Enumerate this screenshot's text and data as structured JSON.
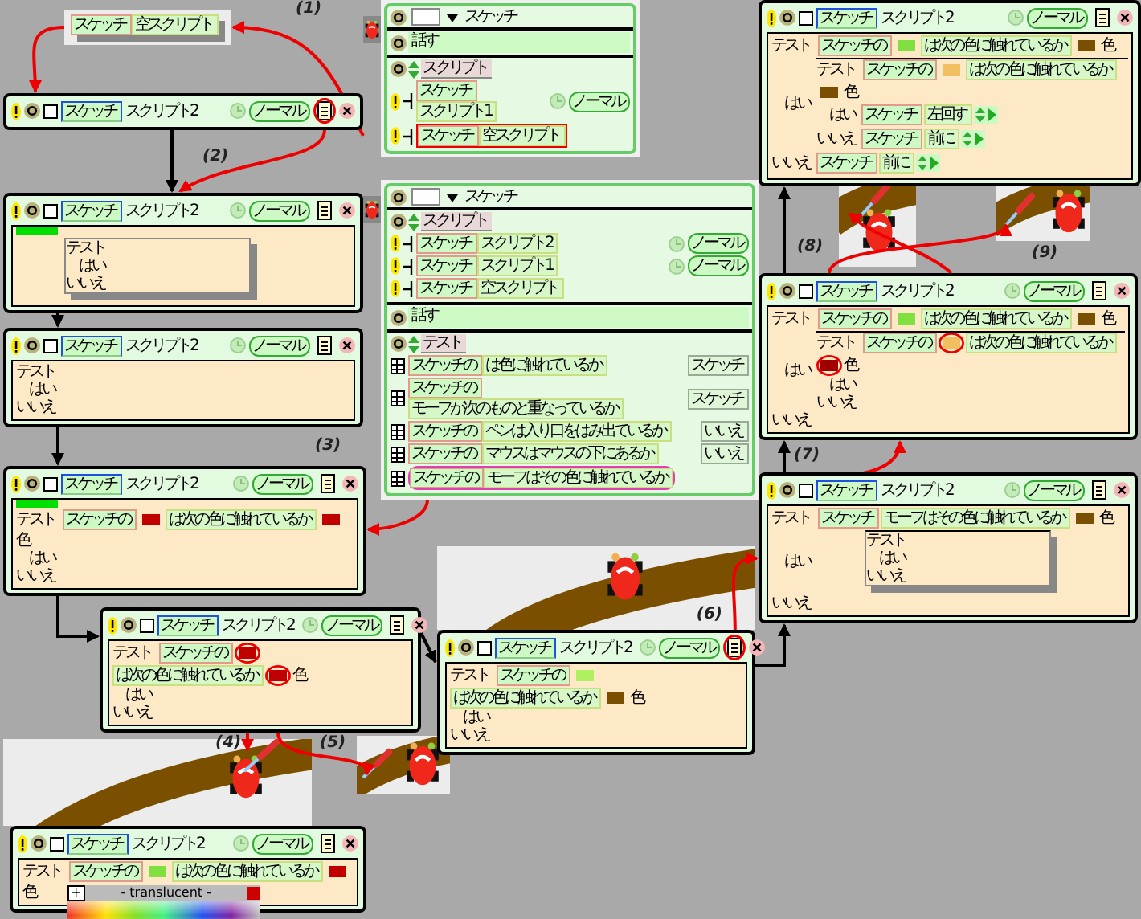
{
  "tile_drag": {
    "tiles": [
      {
        "kind": "object",
        "text": "スケッチ"
      },
      {
        "kind": "phrase",
        "text": "空スクリプト"
      }
    ]
  },
  "viewers": [
    {
      "name": "スケッチ",
      "panes": [
        {
          "kind": "speech",
          "text": "話す"
        },
        {
          "kind": "category",
          "title": "スクリプト",
          "rows": [
            {
              "kind": "script",
              "object": "スケッチ",
              "command": "スクリプト1",
              "mode": "ノーマル",
              "circled": false
            },
            {
              "kind": "script",
              "object": "スケッチ",
              "command": "空スクリプト",
              "circled": true
            }
          ]
        }
      ]
    },
    {
      "name": "スケッチ",
      "panes": [
        {
          "kind": "category",
          "title": "スクリプト",
          "rows": [
            {
              "kind": "script",
              "object": "スケッチ",
              "command": "スクリプト2",
              "mode": "ノーマル",
              "circled": false
            },
            {
              "kind": "script",
              "object": "スケッチ",
              "command": "スクリプト1",
              "mode": "ノーマル",
              "circled": false
            },
            {
              "kind": "script",
              "object": "スケッチ",
              "command": "空スクリプト",
              "circled": false
            }
          ]
        },
        {
          "kind": "speech",
          "text": "話す"
        },
        {
          "kind": "category",
          "title": "テスト",
          "rows": [
            {
              "kind": "test",
              "object": "スケッチの",
              "command": "は色に触れているか",
              "value": "スケッチ",
              "circled": false
            },
            {
              "kind": "test",
              "object": "スケッチの",
              "command": "モーフが次のものと重なっているか",
              "value": "スケッチ",
              "circled": false
            },
            {
              "kind": "test",
              "object": "スケッチの",
              "command": "ペンは入り口をはみ出ているか",
              "value": "いいえ",
              "circled": false
            },
            {
              "kind": "test",
              "object": "スケッチの",
              "command": "マウスはマウスの下にあるか",
              "value": "いいえ",
              "circled": false
            },
            {
              "kind": "test",
              "object": "スケッチの",
              "command": "モーフはその色に触れているか",
              "circled": true
            }
          ]
        }
      ]
    }
  ],
  "scripts": [
    {
      "name": "スケッチ",
      "title": "スクリプト2",
      "mode": "ノーマル",
      "checked": false,
      "menu_circled": true,
      "drop_highlight": false
    },
    {
      "name": "スケッチ",
      "title": "スクリプト2",
      "mode": "ノーマル",
      "checked": false,
      "menu_circled": false,
      "drop_highlight": true,
      "test": {
        "label": "テスト",
        "yes": "はい",
        "no": "いいえ",
        "floating": true
      }
    },
    {
      "name": "スケッチ",
      "title": "スクリプト2",
      "mode": "ノーマル",
      "checked": false,
      "menu_circled": false,
      "drop_highlight": false,
      "test": {
        "label": "テスト",
        "yes": "はい",
        "no": "いいえ",
        "floating": false
      }
    },
    {
      "name": "スケッチ",
      "title": "スクリプト2",
      "mode": "ノーマル",
      "checked": false,
      "menu_circled": false,
      "drop_highlight": true,
      "test": {
        "label": "テスト",
        "condition": [
          {
            "kind": "object",
            "text": "スケッチの"
          },
          {
            "kind": "swatch",
            "color": "#c00000",
            "circled": false
          },
          {
            "kind": "phrase",
            "text": "は次の色に触れているか"
          },
          {
            "kind": "swatch",
            "color": "#c00000",
            "circled": false
          },
          {
            "kind": "word",
            "text": "色"
          }
        ],
        "yes": "はい",
        "no": "いいえ",
        "floating": false
      }
    },
    {
      "name": "スケッチ",
      "title": "スクリプト2",
      "mode": "ノーマル",
      "checked": false,
      "menu_circled": false,
      "drop_highlight": false,
      "test": {
        "label": "テスト",
        "condition": [
          {
            "kind": "object",
            "text": "スケッチの"
          },
          {
            "kind": "swatch",
            "color": "#c00000",
            "circled": true
          },
          {
            "kind": "phrase",
            "text": "は次の色に触れているか"
          },
          {
            "kind": "swatch",
            "color": "#c00000",
            "circled": true
          },
          {
            "kind": "word",
            "text": "色"
          }
        ],
        "yes": "はい",
        "no": "いいえ",
        "floating": false
      }
    },
    {
      "name": "スケッチ",
      "title": "スクリプト2",
      "mode": "ノーマル",
      "checked": false,
      "menu_circled": false,
      "drop_highlight": false,
      "palette": {
        "button": "+",
        "label": "- translucent -"
      },
      "test": {
        "label": "テスト",
        "condition": [
          {
            "kind": "object",
            "text": "スケッチの"
          },
          {
            "kind": "swatch",
            "color": "#80e040",
            "circled": false
          },
          {
            "kind": "phrase",
            "text": "は次の色に触れているか"
          },
          {
            "kind": "swatch",
            "color": "#c00000",
            "circled": false
          },
          {
            "kind": "word",
            "text": "色"
          }
        ],
        "floating": false
      }
    },
    {
      "name": "スケッチ",
      "title": "スクリプト2",
      "mode": "ノーマル",
      "checked": false,
      "menu_circled": true,
      "drop_highlight": false,
      "test": {
        "label": "テスト",
        "condition": [
          {
            "kind": "object",
            "text": "スケッチの"
          },
          {
            "kind": "swatch",
            "color": "#b0f060",
            "circled": false
          },
          {
            "kind": "phrase",
            "text": "は次の色に触れているか"
          },
          {
            "kind": "swatch",
            "color": "#7a5000",
            "circled": false
          },
          {
            "kind": "word",
            "text": "色"
          }
        ],
        "yes": "はい",
        "no": "いいえ",
        "floating": false
      }
    },
    {
      "name": "スケッチ",
      "title": "スクリプト2",
      "mode": "ノーマル",
      "checked": false,
      "menu_circled": false,
      "drop_highlight": false,
      "test": {
        "label": "テスト",
        "condition": [
          {
            "kind": "object",
            "text": "スケッチの"
          },
          {
            "kind": "swatch",
            "color": "#80e040",
            "circled": false
          },
          {
            "kind": "phrase",
            "text": "は次の色に触れているか"
          },
          {
            "kind": "swatch",
            "color": "#7a5000",
            "circled": false
          },
          {
            "kind": "word",
            "text": "色"
          }
        ],
        "yes": "はい",
        "no": "いいえ",
        "floating": false,
        "yes_rows": [
          {
            "kind": "test",
            "label": "テスト",
            "condition": [
              {
                "kind": "object",
                "text": "スケッチの"
              },
              {
                "kind": "swatch",
                "color": "#f0c060",
                "circled": false
              },
              {
                "kind": "phrase",
                "text": "は次の色に触れているか"
              },
              {
                "kind": "swatch",
                "color": "#7a5000",
                "circled": false
              },
              {
                "kind": "word",
                "text": "色"
              }
            ],
            "yes": "はい",
            "no": "いいえ",
            "floating": false,
            "yes_rows": [
              {
                "kind": "command",
                "tiles": [
                  {
                    "kind": "object",
                    "text": "スケッチ"
                  },
                  {
                    "kind": "phrase",
                    "text": "左回す"
                  },
                  {
                    "kind": "stepper"
                  }
                ]
              }
            ],
            "no_rows": [
              {
                "kind": "command",
                "tiles": [
                  {
                    "kind": "object",
                    "text": "スケッチ"
                  },
                  {
                    "kind": "phrase",
                    "text": "前に"
                  },
                  {
                    "kind": "stepper"
                  }
                ]
              }
            ]
          }
        ],
        "no_rows": [
          {
            "kind": "command",
            "tiles": [
              {
                "kind": "object",
                "text": "スケッチ"
              },
              {
                "kind": "phrase",
                "text": "前に"
              },
              {
                "kind": "stepper"
              }
            ]
          }
        ]
      }
    },
    {
      "name": "スケッチ",
      "title": "スクリプト2",
      "mode": "ノーマル",
      "checked": false,
      "menu_circled": false,
      "drop_highlight": false,
      "test": {
        "label": "テスト",
        "condition": [
          {
            "kind": "object",
            "text": "スケッチの"
          },
          {
            "kind": "swatch",
            "color": "#80e040",
            "circled": false
          },
          {
            "kind": "phrase",
            "text": "は次の色に触れているか"
          },
          {
            "kind": "swatch",
            "color": "#7a5000",
            "circled": false
          },
          {
            "kind": "word",
            "text": "色"
          }
        ],
        "yes": "はい",
        "no": "いいえ",
        "floating": false,
        "yes_rows": [
          {
            "kind": "test",
            "label": "テスト",
            "condition": [
              {
                "kind": "object",
                "text": "スケッチの"
              },
              {
                "kind": "swatch",
                "color": "#f0c060",
                "circled": true
              },
              {
                "kind": "phrase",
                "text": "は次の色に触れているか"
              },
              {
                "kind": "swatch",
                "color": "#a00000",
                "circled": true
              },
              {
                "kind": "word",
                "text": "色"
              }
            ],
            "yes": "はい",
            "no": "いいえ",
            "floating": false
          }
        ]
      }
    },
    {
      "name": "スケッチ",
      "title": "スクリプト2",
      "mode": "ノーマル",
      "checked": false,
      "menu_circled": false,
      "drop_highlight": false,
      "test": {
        "label": "テスト",
        "condition": [
          {
            "kind": "object",
            "text": "スケッチ"
          },
          {
            "kind": "phrase",
            "text": "モーフはその色に触れているか"
          },
          {
            "kind": "swatch",
            "color": "#7a5000",
            "circled": false
          },
          {
            "kind": "word",
            "text": "色"
          }
        ],
        "yes": "はい",
        "no": "いいえ",
        "floating": false,
        "yes_rows": [
          {
            "kind": "test",
            "label": "テスト",
            "yes": "はい",
            "no": "いいえ",
            "floating": true
          }
        ]
      }
    }
  ],
  "steps": [
    "(1)",
    "(2)",
    "(3)",
    "(4)",
    "(5)",
    "(6)",
    "(7)",
    "(8)",
    "(9)"
  ]
}
